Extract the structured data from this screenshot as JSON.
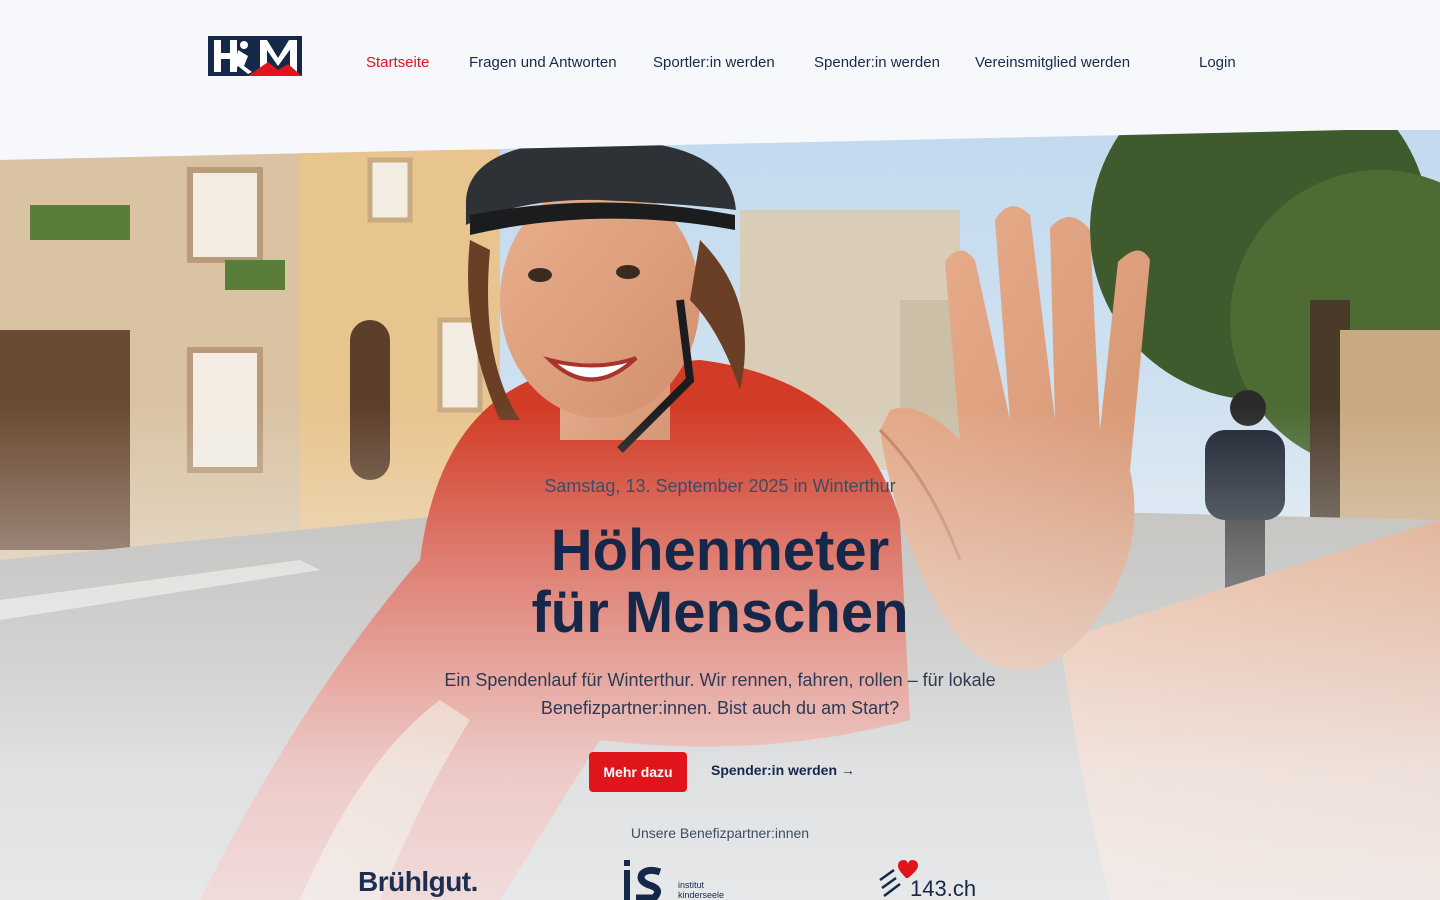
{
  "brand": {
    "logo_text": "H-M",
    "accent": "#e0141b",
    "navy": "#15284a"
  },
  "nav": {
    "items": [
      {
        "label": "Startseite",
        "active": true
      },
      {
        "label": "Fragen und Antworten",
        "active": false
      },
      {
        "label": "Sportler:in werden",
        "active": false
      },
      {
        "label": "Spender:in werden",
        "active": false
      },
      {
        "label": "Vereinsmitglied werden",
        "active": false
      }
    ],
    "login": "Login"
  },
  "hero": {
    "eyebrow": "Samstag, 13. September 2025 in Winterthur",
    "headline_line1": "Höhenmeter",
    "headline_line2": "für Menschen",
    "lead": "Ein Spendenlauf für Winterthur. Wir rennen, fahren, rollen – für lokale Benefizpartner:innen. Bist auch du am Start?",
    "primary_button": "Mehr dazu",
    "secondary_link": "Spender:in werden →"
  },
  "partners": {
    "label": "Unsere Benefizpartner:innen",
    "items": [
      {
        "name": "Brühlgut."
      },
      {
        "name": "is",
        "sub1": "institut",
        "sub2": "kinderseele"
      },
      {
        "name": "143.ch"
      }
    ]
  }
}
